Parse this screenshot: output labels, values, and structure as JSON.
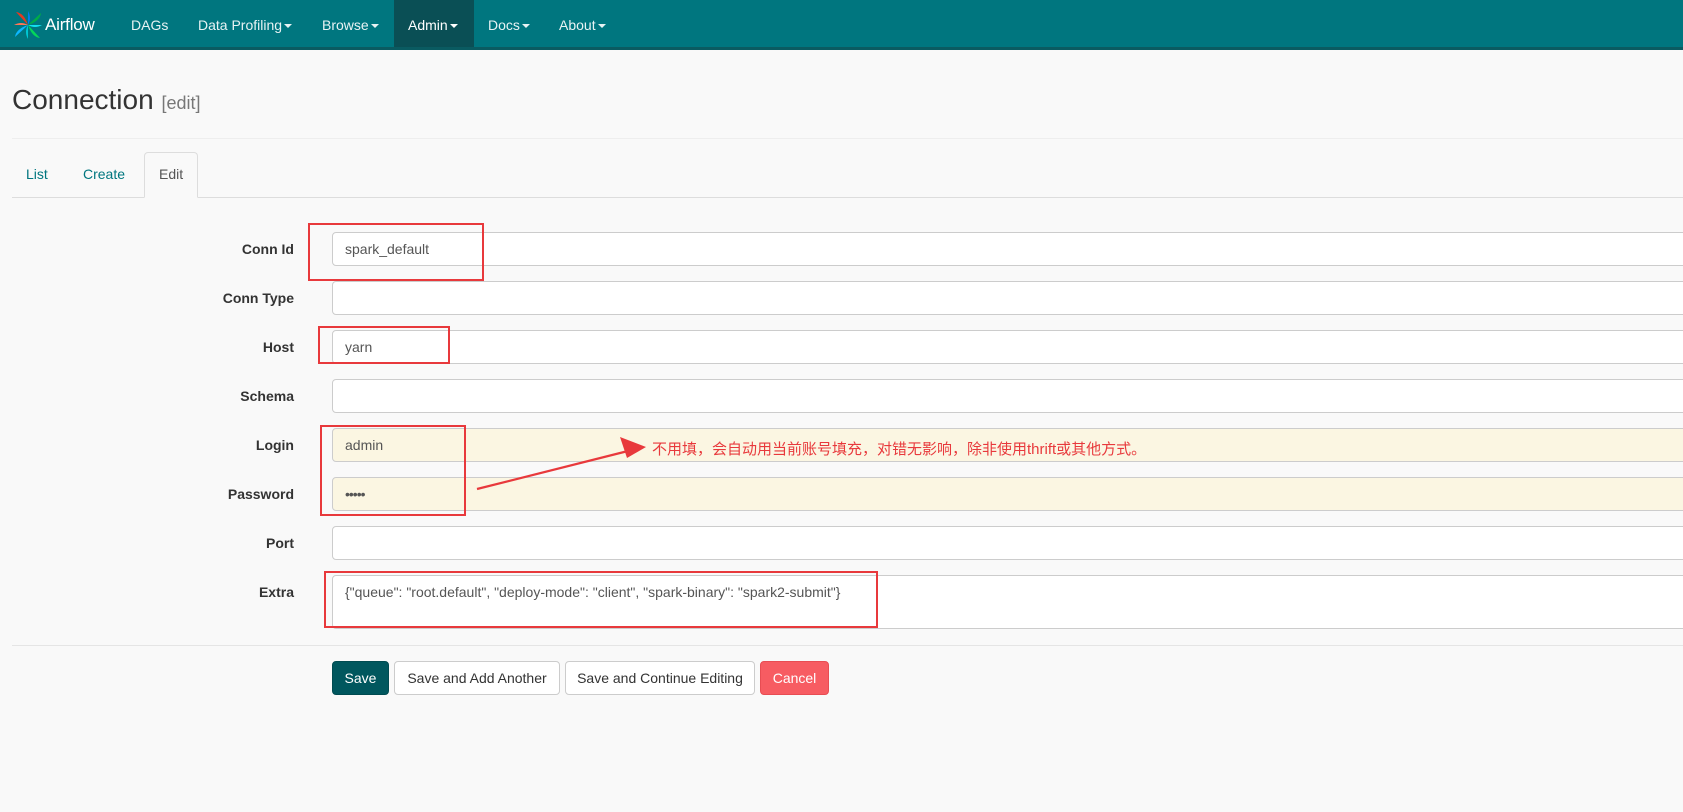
{
  "navbar": {
    "brand": "Airflow",
    "items": [
      {
        "label": "DAGs",
        "dropdown": false
      },
      {
        "label": "Data Profiling",
        "dropdown": true
      },
      {
        "label": "Browse",
        "dropdown": true
      },
      {
        "label": "Admin",
        "dropdown": true,
        "active": true
      },
      {
        "label": "Docs",
        "dropdown": true
      },
      {
        "label": "About",
        "dropdown": true
      }
    ]
  },
  "page": {
    "title": "Connection",
    "subtitle": "[edit]"
  },
  "tabs": [
    {
      "label": "List"
    },
    {
      "label": "Create"
    },
    {
      "label": "Edit",
      "active": true
    }
  ],
  "form": {
    "conn_id": {
      "label": "Conn Id",
      "value": "spark_default"
    },
    "conn_type": {
      "label": "Conn Type",
      "value": ""
    },
    "host": {
      "label": "Host",
      "value": "yarn"
    },
    "schema": {
      "label": "Schema",
      "value": ""
    },
    "login": {
      "label": "Login",
      "value": "admin"
    },
    "password": {
      "label": "Password",
      "value": "•••••"
    },
    "port": {
      "label": "Port",
      "value": ""
    },
    "extra": {
      "label": "Extra",
      "value": "{\"queue\": \"root.default\", \"deploy-mode\": \"client\", \"spark-binary\": \"spark2-submit\"}"
    }
  },
  "buttons": {
    "save": "Save",
    "save_add": "Save and Add Another",
    "save_continue": "Save and Continue Editing",
    "cancel": "Cancel"
  },
  "annotation": {
    "note": "不用填，会自动用当前账号填充，对错无影响，除非使用thrift或其他方式。"
  },
  "colors": {
    "navbar": "#00767f",
    "navbar_active": "#0a4f55",
    "primary_button": "#00575e",
    "danger_button": "#f75c62",
    "annotation": "#e8393c",
    "autofill_background": "#fbf6e2"
  }
}
